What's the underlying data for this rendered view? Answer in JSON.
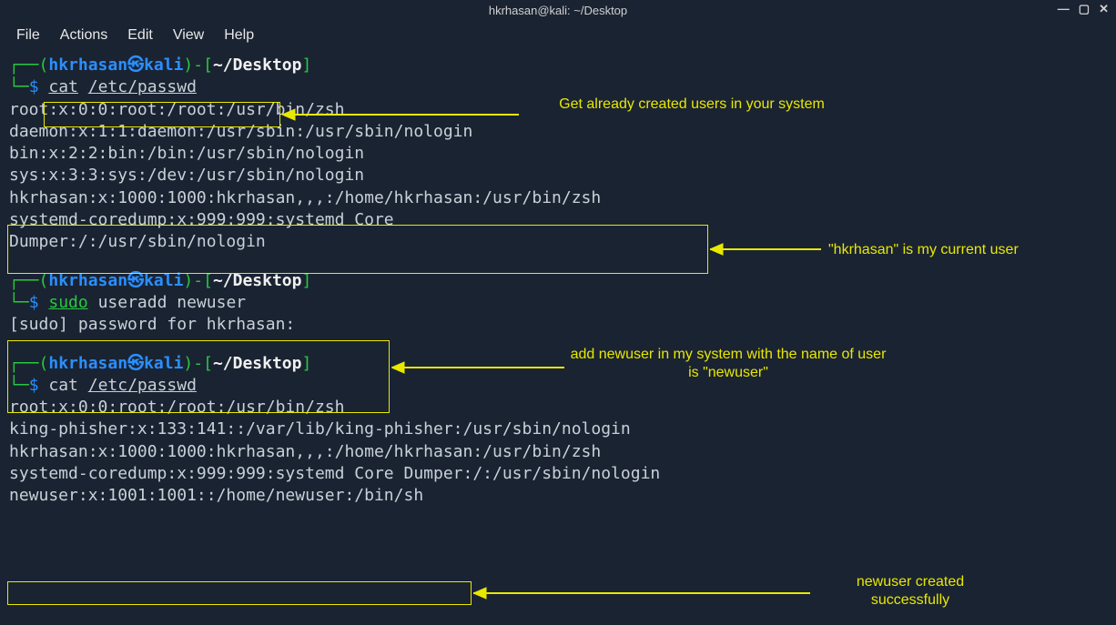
{
  "window": {
    "title": "hkrhasan@kali: ~/Desktop"
  },
  "menu": {
    "file": "File",
    "actions": "Actions",
    "edit": "Edit",
    "view": "View",
    "help": "Help"
  },
  "prompt": {
    "user": "hkrhasan",
    "host": "kali",
    "path": "~/Desktop",
    "symbol": "$"
  },
  "block1": {
    "command": "cat /etc/passwd",
    "out_lines": [
      "root:x:0:0:root:/root:/usr/bin/zsh",
      "daemon:x:1:1:daemon:/usr/sbin:/usr/sbin/nologin",
      "bin:x:2:2:bin:/bin:/usr/sbin/nologin",
      "sys:x:3:3:sys:/dev:/usr/sbin/nologin"
    ],
    "highlight_line": "hkrhasan:x:1000:1000:hkrhasan,,,:/home/hkrhasan:/usr/bin/zsh",
    "tail_lines": [
      "systemd-coredump:x:999:999:systemd Core Dumper:/:/usr/sbin/nologin"
    ]
  },
  "block2": {
    "sudo": "sudo",
    "rest": "useradd newuser",
    "pwline": "[sudo] password for hkrhasan: "
  },
  "block3": {
    "command": "cat /etc/passwd",
    "out_lines": [
      "root:x:0:0:root:/root:/usr/bin/zsh",
      "king-phisher:x:133:141::/var/lib/king-phisher:/usr/sbin/nologin",
      "hkrhasan:x:1000:1000:hkrhasan,,,:/home/hkrhasan:/usr/bin/zsh",
      "systemd-coredump:x:999:999:systemd Core Dumper:/:/usr/sbin/nologin"
    ],
    "highlight_line": "newuser:x:1001:1001::/home/newuser:/bin/sh"
  },
  "annotations": {
    "a1": "Get already created users in your system",
    "a2": "\"hkrhasan\" is my current user",
    "a3": "add newuser in my system with the name of user is \"newuser\"",
    "a4": "newuser created successfully"
  }
}
